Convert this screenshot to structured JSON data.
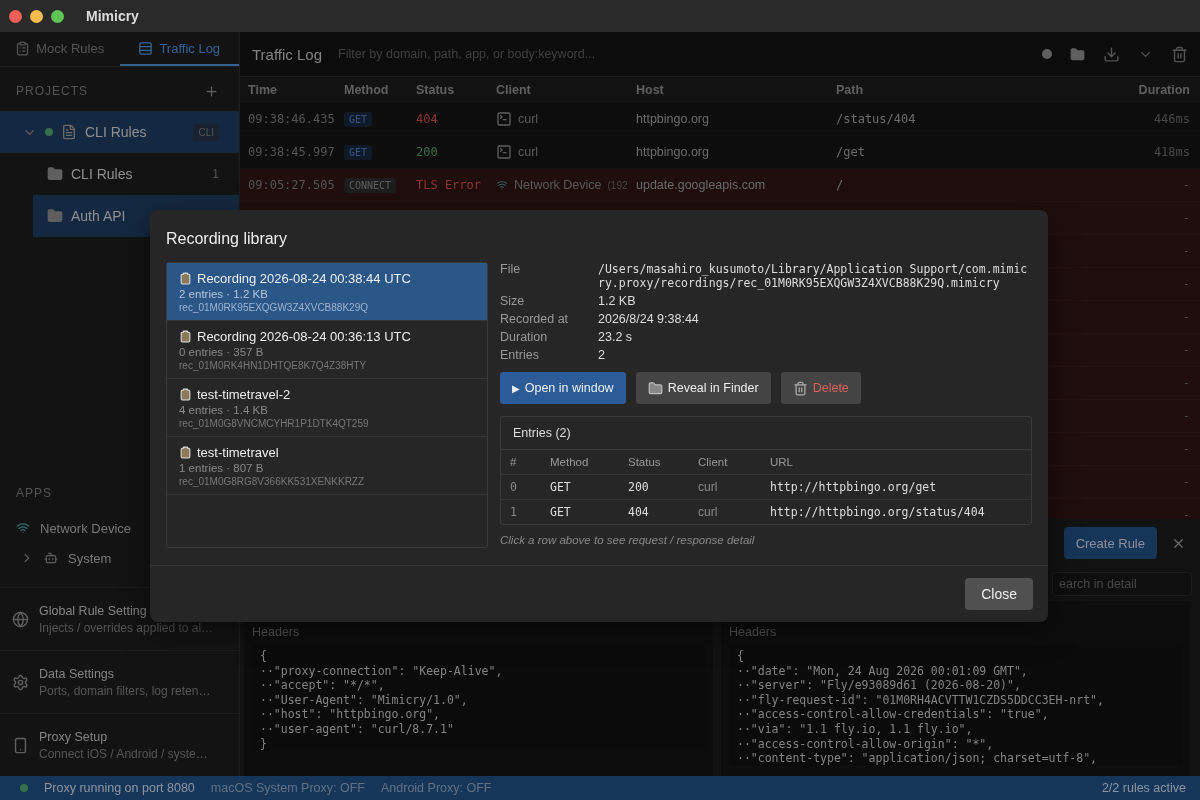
{
  "window": {
    "title": "Mimicry"
  },
  "sidebar": {
    "tabs": [
      {
        "label": "Mock Rules",
        "kind": "rules",
        "selected": false
      },
      {
        "label": "Traffic Log",
        "kind": "log",
        "selected": true
      }
    ],
    "projects_header": "PROJECTS",
    "projects": [
      {
        "name": "CLI Rules",
        "badge": "CLI",
        "expanded": true,
        "selected": true,
        "children": [
          {
            "name": "CLI Rules",
            "count": "1",
            "selected": false
          },
          {
            "name": "Auth API",
            "selected": true
          }
        ]
      }
    ],
    "apps_header": "APPS",
    "apps": [
      {
        "name": "Network Device",
        "kind": "wifi"
      },
      {
        "name": "System",
        "kind": "system",
        "expanded": false
      }
    ],
    "settings": [
      {
        "title": "Global Rule Setting",
        "subtitle": "Injects / overrides applied to al…",
        "kind": "globe"
      },
      {
        "title": "Data Settings",
        "subtitle": "Ports, domain filters, log reten…",
        "kind": "gear"
      },
      {
        "title": "Proxy Setup",
        "subtitle": "Connect iOS / Android / syste…",
        "kind": "phone"
      }
    ]
  },
  "traffic_log": {
    "title": "Traffic Log",
    "filter": {
      "placeholder": "Filter by domain, path, app, or body:keyword..."
    },
    "columns": [
      "Time",
      "Method",
      "Status",
      "Client",
      "Host",
      "Path",
      "Duration"
    ],
    "rows": [
      {
        "failed": false,
        "time": "09:38:46.435",
        "method": "GET",
        "status": {
          "text": "404",
          "kind": "error"
        },
        "client": {
          "name": "curl",
          "kind": "terminal"
        },
        "host": "httpbingo.org",
        "path": "/status/404",
        "duration": "446ms"
      },
      {
        "failed": false,
        "time": "09:38:45.997",
        "method": "GET",
        "status": {
          "text": "200",
          "kind": "success"
        },
        "client": {
          "name": "curl",
          "kind": "terminal"
        },
        "host": "httpbingo.org",
        "path": "/get",
        "duration": "418ms"
      },
      {
        "failed": true,
        "time": "09:05:27.505",
        "method": "CONNECT",
        "status": {
          "text": "TLS Error",
          "kind": "error"
        },
        "client": {
          "name": "Network Device",
          "extra": "(192",
          "kind": "wifi"
        },
        "host": "update.googleapis.com",
        "path": "/",
        "duration": "-"
      },
      {
        "failed": true,
        "duration": "-"
      },
      {
        "failed": true,
        "duration": "-"
      },
      {
        "failed": true,
        "duration": "-"
      },
      {
        "failed": true,
        "duration": "-"
      },
      {
        "failed": true,
        "duration": "-"
      },
      {
        "failed": true,
        "duration": "-"
      },
      {
        "failed": true,
        "duration": "-"
      },
      {
        "failed": true,
        "duration": "-"
      },
      {
        "failed": true,
        "duration": "-"
      },
      {
        "failed": true,
        "duration": "-"
      }
    ]
  },
  "detail": {
    "create_rule": "Create Rule",
    "search": {
      "placeholder": "earch in detail"
    },
    "panes": [
      {
        "label": "Headers",
        "lines": [
          "{",
          "··\"proxy-connection\": \"Keep-Alive\",",
          "··\"accept\": \"*/*\",",
          "··\"User-Agent\": \"Mimicry/1.0\",",
          "··\"host\": \"httpbingo.org\",",
          "··\"user-agent\": \"curl/8.7.1\"",
          "}"
        ]
      },
      {
        "label": "Headers",
        "lines": [
          "{",
          "··\"date\": \"Mon, 24 Aug 2026 00:01:09 GMT\",",
          "··\"server\": \"Fly/e93089d61 (2026-08-20)\",",
          "··\"fly-request-id\": \"01M0RH4ACVTTW1CZDS5DDCC3EH-nrt\",",
          "··\"access-control-allow-credentials\": \"true\",",
          "··\"via\": \"1.1 fly.io, 1.1 fly.io\",",
          "··\"access-control-allow-origin\": \"*\",",
          "··\"content-type\": \"application/json; charset=utf-8\","
        ]
      }
    ]
  },
  "recording_library": {
    "title": "Recording library",
    "recordings": [
      {
        "name": "Recording 2026-08-24 00:38:44 UTC",
        "meta": "2 entries · 1.2 KB",
        "id": "rec_01M0RK95EXQGW3Z4XVCB88K29Q",
        "selected": true
      },
      {
        "name": "Recording 2026-08-24 00:36:13 UTC",
        "meta": "0 entries · 357 B",
        "id": "rec_01M0RK4HN1DHTQE8K7Q4Z38HTY",
        "selected": false
      },
      {
        "name": "test-timetravel-2",
        "meta": "4 entries · 1.4 KB",
        "id": "rec_01M0G8VNCMCYHR1P1DTK4QT259",
        "selected": false
      },
      {
        "name": "test-timetravel",
        "meta": "1 entries · 807 B",
        "id": "rec_01M0G8RG8V366KK531XENKKRZZ",
        "selected": false
      }
    ],
    "details": [
      {
        "label": "File",
        "value": "/Users/masahiro_kusumoto/Library/Application Support/com.mimicry.proxy/recordings/rec_01M0RK95EXQGW3Z4XVCB88K29Q.mimicry",
        "kind": "mono"
      },
      {
        "label": "Size",
        "value": "1.2 KB",
        "kind": "text"
      },
      {
        "label": "Recorded at",
        "value": "2026/8/24 9:38:44",
        "kind": "text"
      },
      {
        "label": "Duration",
        "value": "23.2 s",
        "kind": "text"
      },
      {
        "label": "Entries",
        "value": "2",
        "kind": "text"
      }
    ],
    "actions": [
      {
        "label": "Open in window",
        "glyph": "▶",
        "kind": "primary"
      },
      {
        "label": "Reveal in Finder",
        "kind": "reveal"
      },
      {
        "label": "Delete",
        "kind": "danger"
      }
    ],
    "entries": {
      "title": "Entries (2)",
      "columns": [
        "#",
        "Method",
        "Status",
        "Client",
        "URL"
      ],
      "rows": [
        [
          "0",
          "GET",
          "200",
          "curl",
          "http://httpbingo.org/get"
        ],
        [
          "1",
          "GET",
          "404",
          "curl",
          "http://httpbingo.org/status/404"
        ]
      ]
    },
    "hint": "Click a row above to see request / response detail",
    "close": "Close"
  },
  "status_bar": {
    "items": [
      {
        "text": "Proxy running on port 8080",
        "kind": "running"
      },
      {
        "text": "macOS System Proxy: OFF",
        "kind": "plain"
      },
      {
        "text": "Android Proxy: OFF",
        "kind": "plain"
      }
    ],
    "rules": "2/2 rules active"
  }
}
